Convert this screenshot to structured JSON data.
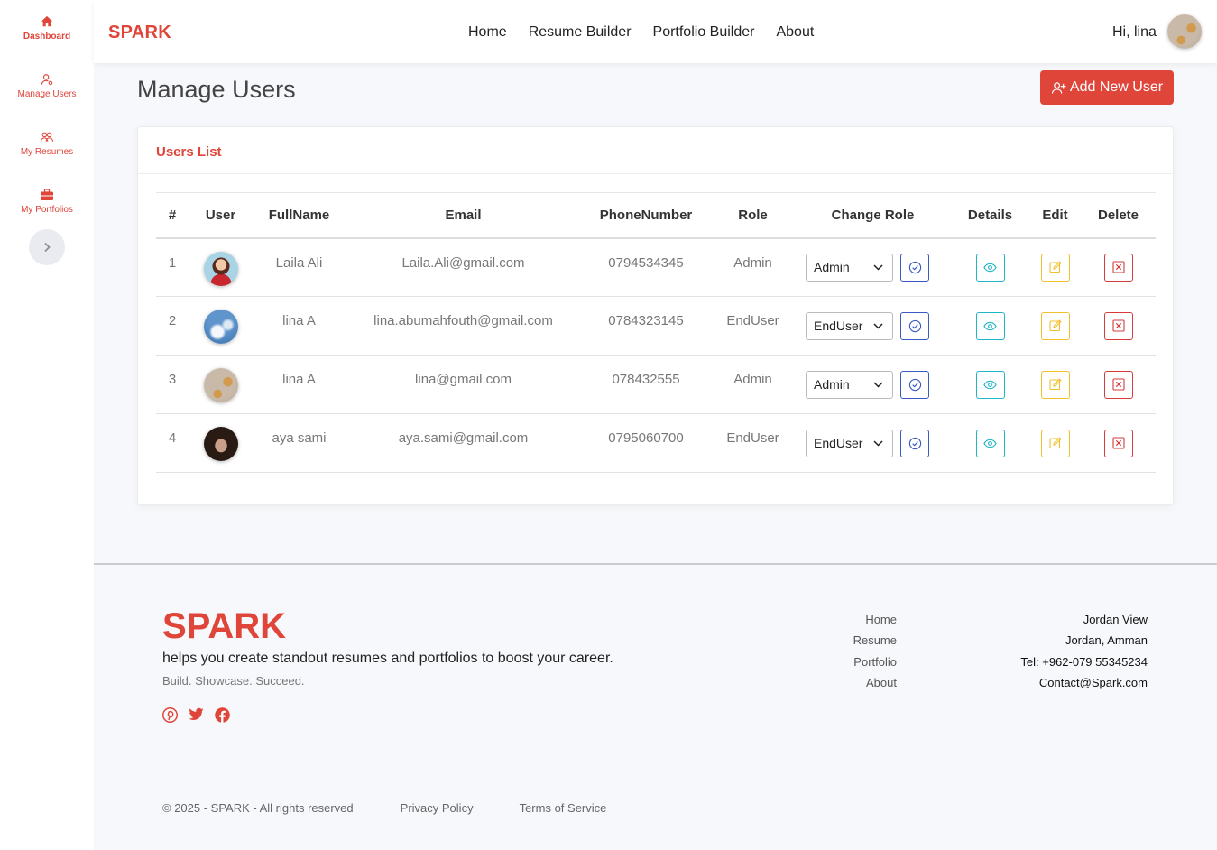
{
  "sidebar": {
    "items": [
      {
        "label": "Dashboard",
        "icon": "home-icon"
      },
      {
        "label": "Manage Users",
        "icon": "user-cog-icon"
      },
      {
        "label": "My Resumes",
        "icon": "users-icon"
      },
      {
        "label": "My Portfolios",
        "icon": "briefcase-icon"
      }
    ],
    "toggle_icon": "chevron-right-icon"
  },
  "header": {
    "brand": "SPARK",
    "nav": [
      "Home",
      "Resume Builder",
      "Portfolio Builder",
      "About"
    ],
    "greeting": "Hi, lina"
  },
  "main": {
    "title": "Manage Users",
    "add_button": "Add New User",
    "card_title": "Users List",
    "columns": [
      "#",
      "User",
      "FullName",
      "Email",
      "PhoneNumber",
      "Role",
      "Change Role",
      "Details",
      "Edit",
      "Delete"
    ],
    "rows": [
      {
        "num": "1",
        "name": "Laila Ali",
        "email": "Laila.Ali@gmail.com",
        "phone": "0794534345",
        "role": "Admin",
        "select": "Admin"
      },
      {
        "num": "2",
        "name": "lina A",
        "email": "lina.abumahfouth@gmail.com",
        "phone": "0784323145",
        "role": "EndUser",
        "select": "EndUser"
      },
      {
        "num": "3",
        "name": "lina A",
        "email": "lina@gmail.com",
        "phone": "078432555",
        "role": "Admin",
        "select": "Admin"
      },
      {
        "num": "4",
        "name": "aya sami",
        "email": "aya.sami@gmail.com",
        "phone": "0795060700",
        "role": "EndUser",
        "select": "EndUser"
      }
    ]
  },
  "footer": {
    "brand": "SPARK",
    "tagline": "helps you create standout resumes and portfolios to boost your career.",
    "sub": "Build. Showcase. Succeed.",
    "social": [
      "pinterest-icon",
      "twitter-icon",
      "facebook-icon"
    ],
    "links": [
      "Home",
      "Resume",
      "Portfolio",
      "About"
    ],
    "contact": [
      "Jordan View",
      "Jordan, Amman",
      "Tel: +962-079 55345234",
      "Contact@Spark.com"
    ],
    "copyright": "© 2025 - SPARK - All rights reserved",
    "privacy": "Privacy Policy",
    "terms": "Terms of Service"
  },
  "colors": {
    "accent": "#e0453a",
    "blue": "#3b5bc4",
    "teal": "#20b6c9",
    "yellow": "#f2c02c",
    "red": "#d63b3b"
  }
}
